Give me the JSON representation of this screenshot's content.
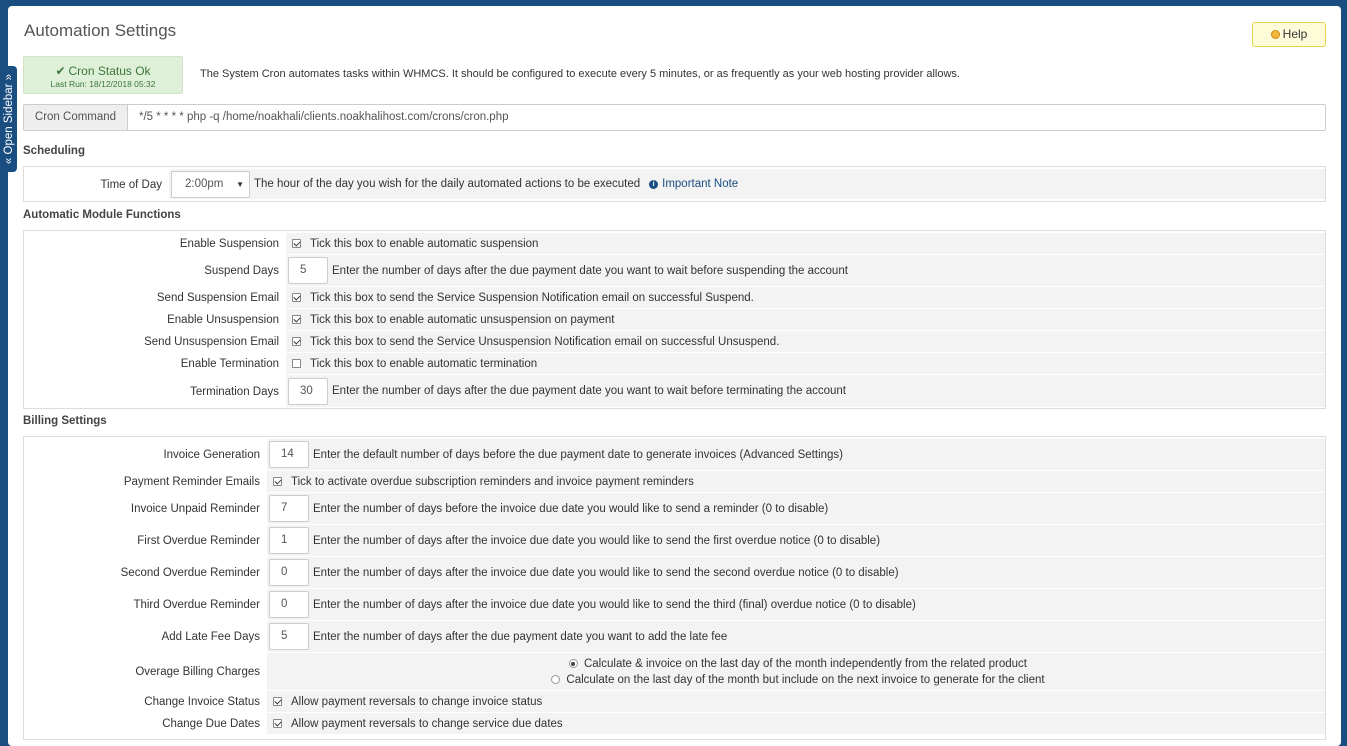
{
  "page_title": "Automation Settings",
  "help_label": "Help",
  "sidebar_tab_label": "« Open Sidebar »",
  "cron": {
    "status": "Cron Status Ok",
    "last_run": "Last Run: 18/12/2018 05:32",
    "description": "The System Cron automates tasks within WHMCS. It should be configured to execute every 5 minutes, or as frequently as your web hosting provider allows.",
    "command_label": "Cron Command",
    "command_value": "*/5 * * * * php -q /home/noakhali/clients.noakhalihost.com/crons/cron.php"
  },
  "scheduling": {
    "title": "Scheduling",
    "time_of_day_label": "Time of Day",
    "time_of_day_value": "2:00pm",
    "time_of_day_desc": "The hour of the day you wish for the daily automated actions to be executed",
    "important_note": "Important Note"
  },
  "module": {
    "title": "Automatic Module Functions",
    "enable_suspension": {
      "label": "Enable Suspension",
      "checked": true,
      "desc": "Tick this box to enable automatic suspension"
    },
    "suspend_days": {
      "label": "Suspend Days",
      "value": "5",
      "desc": "Enter the number of days after the due payment date you want to wait before suspending the account"
    },
    "send_suspension_email": {
      "label": "Send Suspension Email",
      "checked": true,
      "desc": "Tick this box to send the Service Suspension Notification email on successful Suspend."
    },
    "enable_unsuspension": {
      "label": "Enable Unsuspension",
      "checked": true,
      "desc": "Tick this box to enable automatic unsuspension on payment"
    },
    "send_unsuspension_email": {
      "label": "Send Unsuspension Email",
      "checked": true,
      "desc": "Tick this box to send the Service Unsuspension Notification email on successful Unsuspend."
    },
    "enable_termination": {
      "label": "Enable Termination",
      "checked": false,
      "desc": "Tick this box to enable automatic termination"
    },
    "termination_days": {
      "label": "Termination Days",
      "value": "30",
      "desc": "Enter the number of days after the due payment date you want to wait before terminating the account"
    }
  },
  "billing": {
    "title": "Billing Settings",
    "invoice_generation": {
      "label": "Invoice Generation",
      "value": "14",
      "desc": "Enter the default number of days before the due payment date to generate invoices",
      "link": "(Advanced Settings)"
    },
    "payment_reminder_emails": {
      "label": "Payment Reminder Emails",
      "checked": true,
      "desc": "Tick to activate overdue subscription reminders and invoice payment reminders"
    },
    "invoice_unpaid_reminder": {
      "label": "Invoice Unpaid Reminder",
      "value": "7",
      "desc": "Enter the number of days before the invoice due date you would like to send a reminder (0 to disable)"
    },
    "first_overdue_reminder": {
      "label": "First Overdue Reminder",
      "value": "1",
      "desc": "Enter the number of days after the invoice due date you would like to send the first overdue notice (0 to disable)"
    },
    "second_overdue_reminder": {
      "label": "Second Overdue Reminder",
      "value": "0",
      "desc": "Enter the number of days after the invoice due date you would like to send the second overdue notice (0 to disable)"
    },
    "third_overdue_reminder": {
      "label": "Third Overdue Reminder",
      "value": "0",
      "desc": "Enter the number of days after the invoice due date you would like to send the third (final) overdue notice (0 to disable)"
    },
    "add_late_fee_days": {
      "label": "Add Late Fee Days",
      "value": "5",
      "desc": "Enter the number of days after the due payment date you want to add the late fee"
    },
    "overage_billing": {
      "label": "Overage Billing Charges",
      "option1": "Calculate & invoice on the last day of the month independently from the related product",
      "option2": "Calculate on the last day of the month but include on the next invoice to generate for the client",
      "selected": 1
    },
    "change_invoice_status": {
      "label": "Change Invoice Status",
      "checked": true,
      "desc": "Allow payment reversals to change invoice status"
    },
    "change_due_dates": {
      "label": "Change Due Dates",
      "checked": true,
      "desc": "Allow payment reversals to change service due dates"
    }
  }
}
